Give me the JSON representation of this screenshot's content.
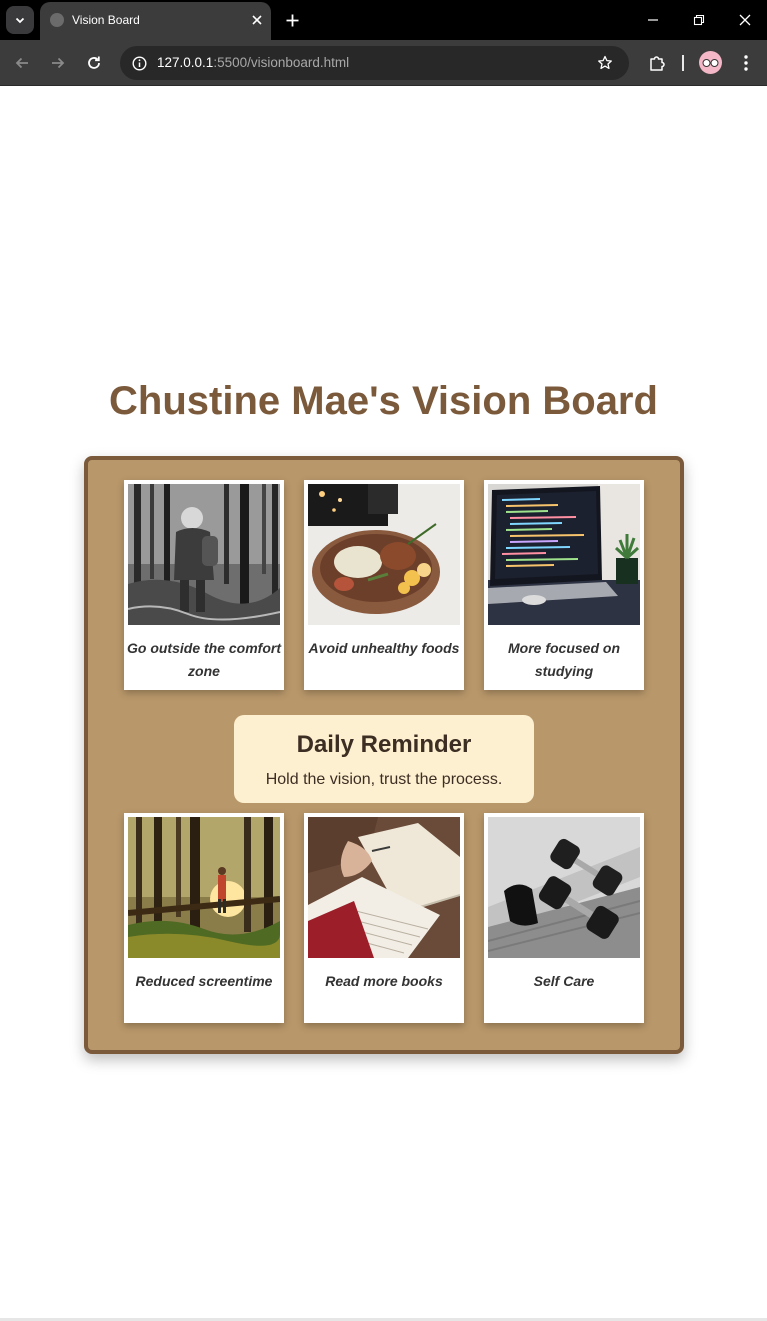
{
  "browser": {
    "tab_title": "Vision Board",
    "url_host": "127.0.0.1",
    "url_path": ":5500/visionboard.html"
  },
  "page": {
    "title": "Chustine Mae's Vision Board",
    "reminder": {
      "heading": "Daily Reminder",
      "text": "Hold the vision, trust the process."
    },
    "cards": [
      {
        "caption": "Go outside the comfort zone",
        "image": "person-walking-forest-bw-photo"
      },
      {
        "caption": "Avoid unhealthy foods",
        "image": "healthy-food-bowl-photo"
      },
      {
        "caption": "More focused on studying",
        "image": "laptop-code-photo"
      },
      {
        "caption": "Reduced screentime",
        "image": "person-forest-sunset-photo"
      },
      {
        "caption": "Read more books",
        "image": "open-books-notes-photo"
      },
      {
        "caption": "Self Care",
        "image": "dumbbells-photo"
      }
    ]
  },
  "colors": {
    "title": "#7b5a3c",
    "board_fill": "#b8976a",
    "board_border": "#7b5a3c",
    "reminder_bg": "#fdf0d0"
  }
}
